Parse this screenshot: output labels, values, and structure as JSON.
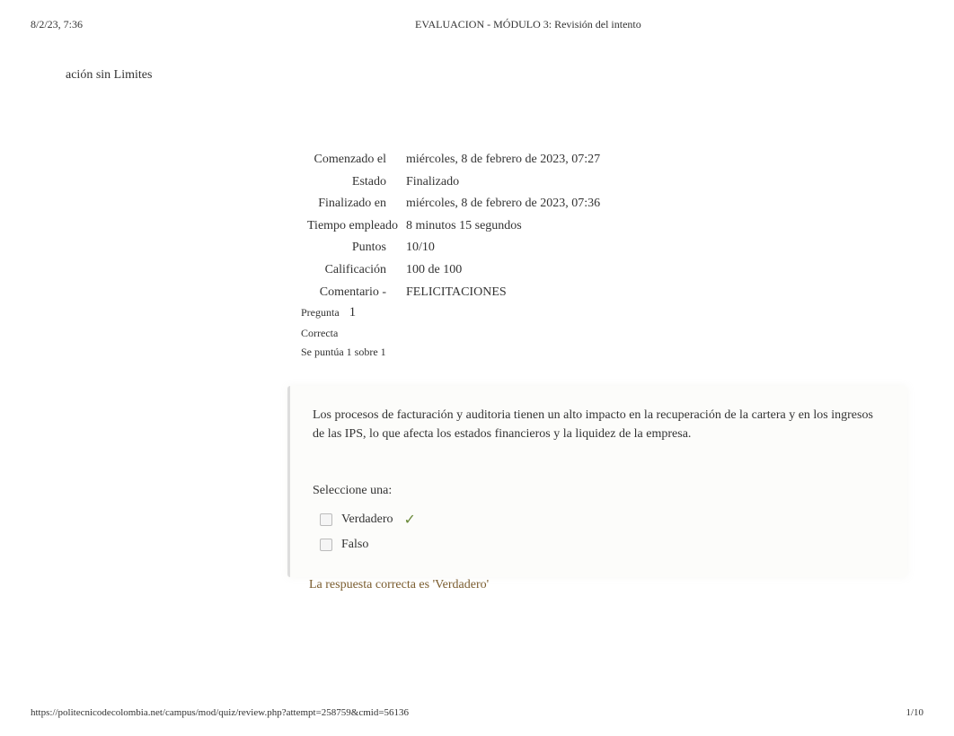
{
  "header": {
    "timestamp": "8/2/23, 7:36",
    "title": "EVALUACION - MÓDULO 3: Revisión del intento"
  },
  "subtitle": "ación sin Limites",
  "summary": {
    "rows": [
      {
        "label": "Comenzado el",
        "value": "miércoles, 8 de febrero de 2023, 07:27"
      },
      {
        "label": "Estado",
        "value": "Finalizado"
      },
      {
        "label": "Finalizado en",
        "value": "miércoles, 8 de febrero de 2023, 07:36"
      },
      {
        "label": "Tiempo empleado",
        "value": "8 minutos 15 segundos"
      },
      {
        "label": "Puntos",
        "value": "10/10"
      },
      {
        "label": "Calificación",
        "value": "100 de 100"
      },
      {
        "label": "Comentario -",
        "value": "FELICITACIONES"
      }
    ]
  },
  "question": {
    "label": "Pregunta",
    "number": "1",
    "status": "Correcta",
    "score": "Se puntúa 1 sobre 1",
    "text": "Los procesos de facturación y auditoria tienen un alto impacto en la recuperación de la cartera y en los ingresos de las IPS, lo que afecta los estados financieros y la liquidez de la empresa.",
    "select_prompt": "Seleccione una:",
    "options": [
      {
        "text": "Verdadero",
        "selected": true,
        "correct": true
      },
      {
        "text": "Falso",
        "selected": false,
        "correct": false
      }
    ],
    "correct_answer": "La respuesta correcta es 'Verdadero'"
  },
  "footer": {
    "url": "https://politecnicodecolombia.net/campus/mod/quiz/review.php?attempt=258759&cmid=56136",
    "page": "1/10"
  }
}
